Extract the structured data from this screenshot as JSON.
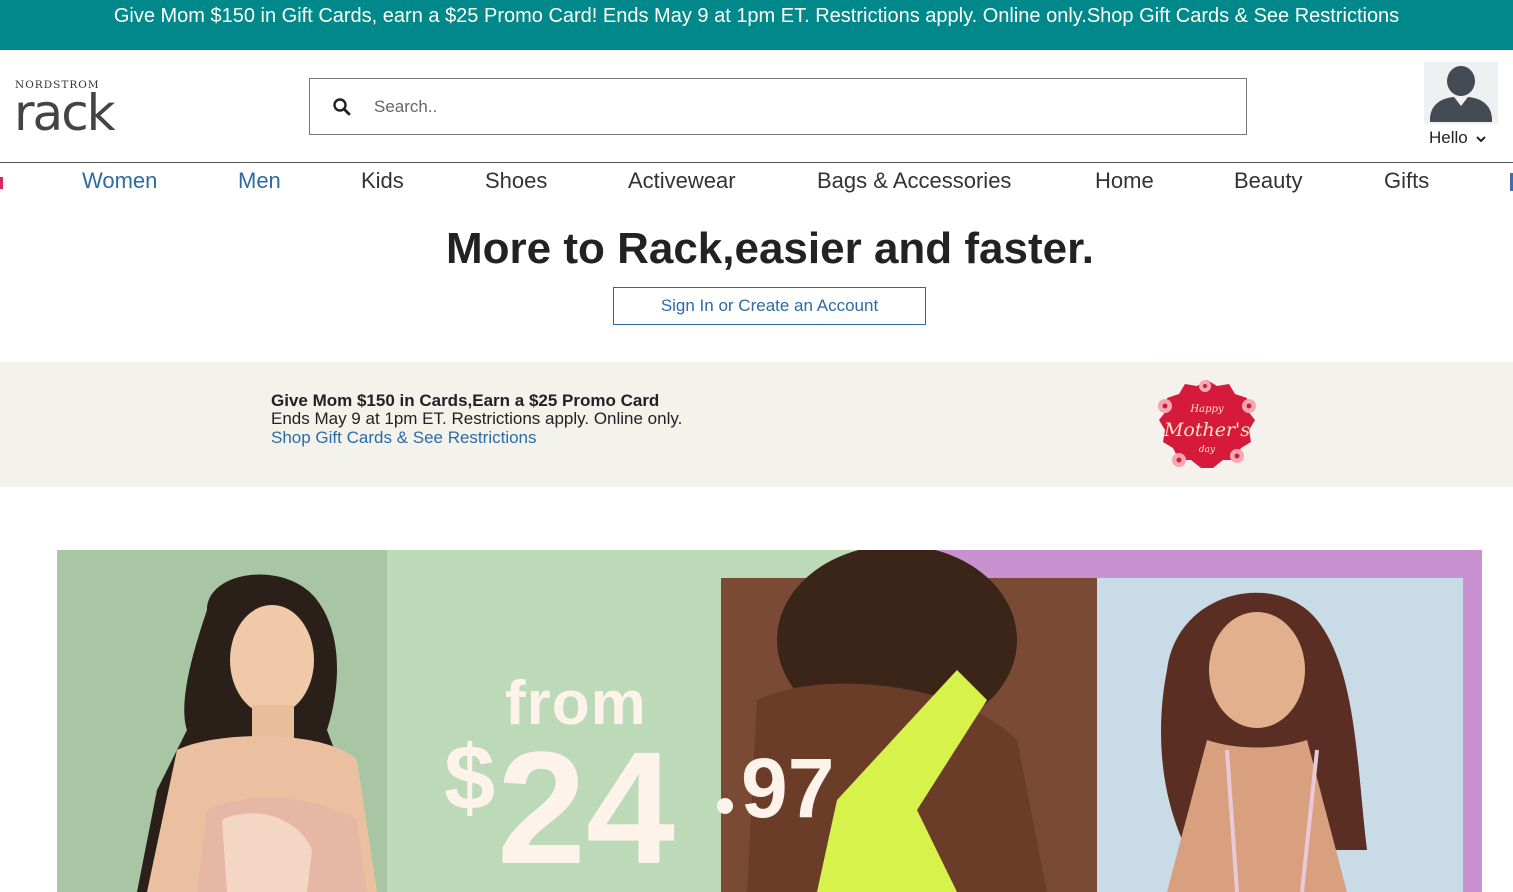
{
  "promo_bar": {
    "text": "Give Mom $150 in Gift Cards, earn a $25 Promo Card! Ends May 9 at 1pm ET. Restrictions apply. Online only.Shop Gift Cards & See Restrictions"
  },
  "header": {
    "logo_top": "NORDSTROM",
    "logo_main": "rack",
    "search_placeholder": "Search..",
    "account_label": "Hello"
  },
  "nav": {
    "items": [
      {
        "label": "Women"
      },
      {
        "label": "Men"
      },
      {
        "label": "Kids"
      },
      {
        "label": "Shoes"
      },
      {
        "label": "Activewear"
      },
      {
        "label": "Bags & Accessories"
      },
      {
        "label": "Home"
      },
      {
        "label": "Beauty"
      },
      {
        "label": "Gifts"
      }
    ]
  },
  "hero": {
    "title": "More to Rack,easier and faster.",
    "signin_label": "Sign In or Create an Account"
  },
  "mom_banner": {
    "title": "Give Mom $150 in Cards,Earn a $25 Promo Card",
    "subtitle": "Ends May 9 at 1pm ET. Restrictions apply. Online only.",
    "link": "Shop Gift Cards & See Restrictions",
    "card_line1": "Happy",
    "card_line2": "Mother's",
    "card_line3": "day"
  },
  "sale_banner": {
    "from": "from",
    "dollar": "$",
    "price": "24",
    "cents": "97"
  },
  "colors": {
    "promo_bg": "#00888a",
    "link_blue": "#2d6aa6",
    "banner_bg": "#f3f3ec"
  }
}
